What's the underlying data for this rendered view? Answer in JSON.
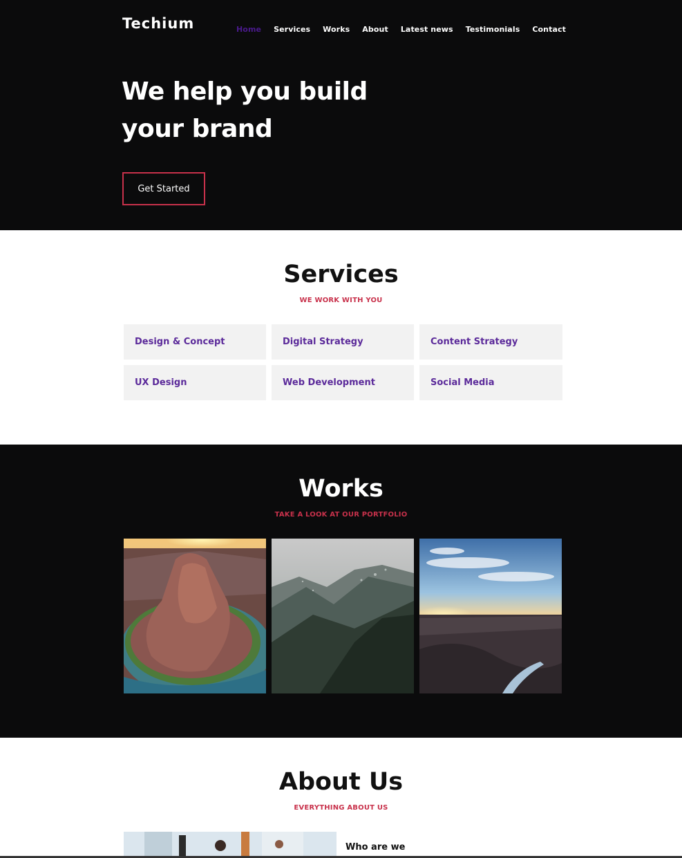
{
  "header": {
    "logo": "Techium",
    "nav": [
      "Home",
      "Services",
      "Works",
      "About",
      "Latest news",
      "Testimonials",
      "Contact"
    ]
  },
  "hero": {
    "title_line1": "We help you build",
    "title_line2": "your brand",
    "cta_label": "Get Started"
  },
  "services": {
    "title": "Services",
    "subtitle": "WE WORK WITH YOU",
    "items": [
      "Design & Concept",
      "Digital Strategy",
      "Content Strategy",
      "UX Design",
      "Web Development",
      "Social Media"
    ]
  },
  "works": {
    "title": "Works",
    "subtitle": "TAKE A LOOK AT OUR PORTFOLIO",
    "items": [
      "horseshoe-bend-photo",
      "misty-mountains-photo",
      "canyon-sunset-photo"
    ]
  },
  "about": {
    "title": "About Us",
    "subtitle": "EVERYTHING ABOUT US",
    "who_label": "Who are we"
  },
  "colors": {
    "accent_red": "#c8314b",
    "accent_purple": "#5b2a9a",
    "nav_active": "#4a1a8c",
    "dark_bg": "#0b0b0c",
    "card_bg": "#f2f2f2"
  }
}
